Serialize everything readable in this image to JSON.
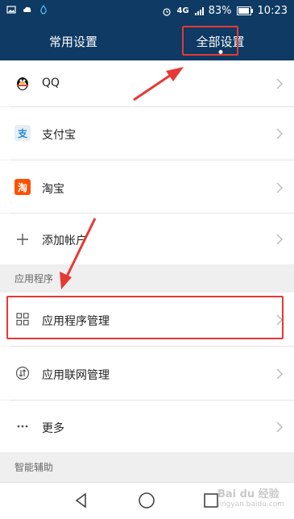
{
  "status_bar": {
    "network_label": "4G",
    "battery_percent": "83%",
    "time": "10:23"
  },
  "tabs": [
    {
      "label": "常用设置",
      "active": false
    },
    {
      "label": "全部设置",
      "active": true
    }
  ],
  "accounts": [
    {
      "label": "QQ",
      "icon": "qq-penguin-icon"
    },
    {
      "label": "支付宝",
      "icon": "alipay-icon",
      "icon_text": "支"
    },
    {
      "label": "淘宝",
      "icon": "taobao-icon",
      "icon_text": "淘"
    },
    {
      "label": "添加帐户",
      "icon": "plus-icon"
    }
  ],
  "sections": {
    "apps_header": "应用程序",
    "assist_header": "智能辅助"
  },
  "apps": [
    {
      "label": "应用程序管理",
      "icon": "grid-icon"
    },
    {
      "label": "应用联网管理",
      "icon": "network-arrows-icon"
    },
    {
      "label": "更多",
      "icon": "more-dots-icon"
    }
  ],
  "watermark": {
    "brand": "Bai du 经验",
    "site": "jingyan.baidu.com"
  },
  "colors": {
    "header_bg": "#0e3a63",
    "highlight_red": "#e53935",
    "alipay_blue": "#1a8ad9",
    "taobao_orange": "#ff5000"
  }
}
